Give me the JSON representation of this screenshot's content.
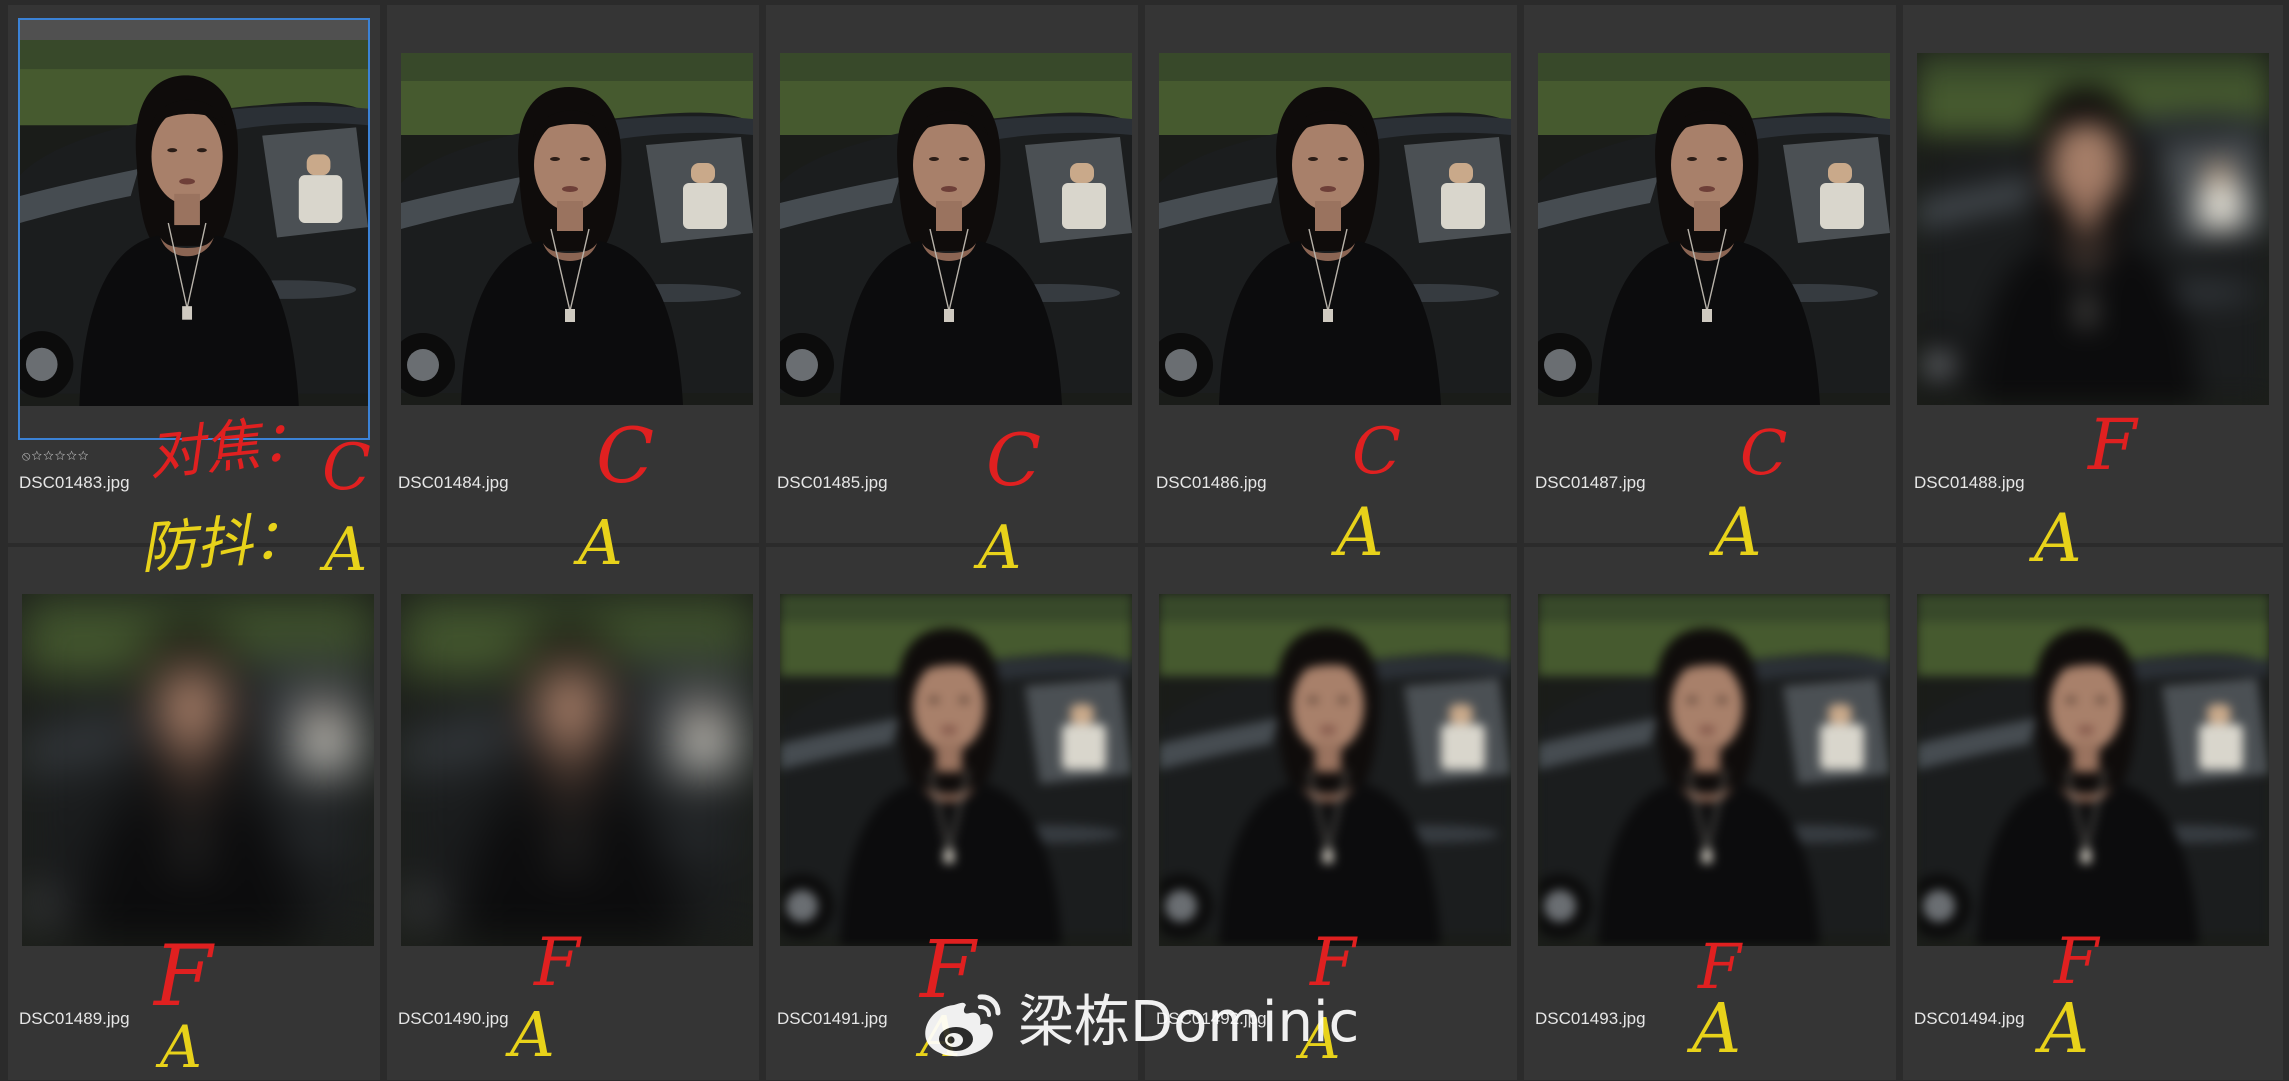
{
  "browser": {
    "files": [
      {
        "name": "DSC01483.jpg",
        "selected": true,
        "blur": 0
      },
      {
        "name": "DSC01484.jpg",
        "selected": false,
        "blur": 0
      },
      {
        "name": "DSC01485.jpg",
        "selected": false,
        "blur": 0
      },
      {
        "name": "DSC01486.jpg",
        "selected": false,
        "blur": 0
      },
      {
        "name": "DSC01487.jpg",
        "selected": false,
        "blur": 0
      },
      {
        "name": "DSC01488.jpg",
        "selected": false,
        "blur": 14
      },
      {
        "name": "DSC01489.jpg",
        "selected": false,
        "blur": 24
      },
      {
        "name": "DSC01490.jpg",
        "selected": false,
        "blur": 24
      },
      {
        "name": "DSC01491.jpg",
        "selected": false,
        "blur": 5
      },
      {
        "name": "DSC01492.jpg",
        "selected": false,
        "blur": 5
      },
      {
        "name": "DSC01493.jpg",
        "selected": false,
        "blur": 5
      },
      {
        "name": "DSC01494.jpg",
        "selected": false,
        "blur": 5
      }
    ],
    "selected_rating": "⦸☆☆☆☆☆"
  },
  "annotations": {
    "legend_focus": "对焦：",
    "legend_focus_grade": "C",
    "legend_shake": "防抖：",
    "legend_shake_grade": "A",
    "grades": [
      {
        "focus": "C",
        "shake": "A"
      },
      {
        "focus": "C",
        "shake": "A"
      },
      {
        "focus": "C",
        "shake": "A"
      },
      {
        "focus": "C",
        "shake": "A"
      },
      {
        "focus": "C",
        "shake": "A"
      },
      {
        "focus": "F",
        "shake": "A"
      },
      {
        "focus": "F",
        "shake": "A"
      },
      {
        "focus": "F",
        "shake": "A"
      },
      {
        "focus": "F",
        "shake": "A"
      },
      {
        "focus": "F",
        "shake": "A"
      },
      {
        "focus": "F",
        "shake": "A"
      },
      {
        "focus": "F",
        "shake": "A"
      }
    ]
  },
  "watermark": {
    "text": "梁栋Dominic",
    "logo_icon": "weibo-logo-icon"
  },
  "colors": {
    "background": "#2b2b2b",
    "cell": "#353535",
    "selection": "#3b82d6",
    "annotation_red": "#e02020",
    "annotation_yellow": "#e8d21a"
  }
}
